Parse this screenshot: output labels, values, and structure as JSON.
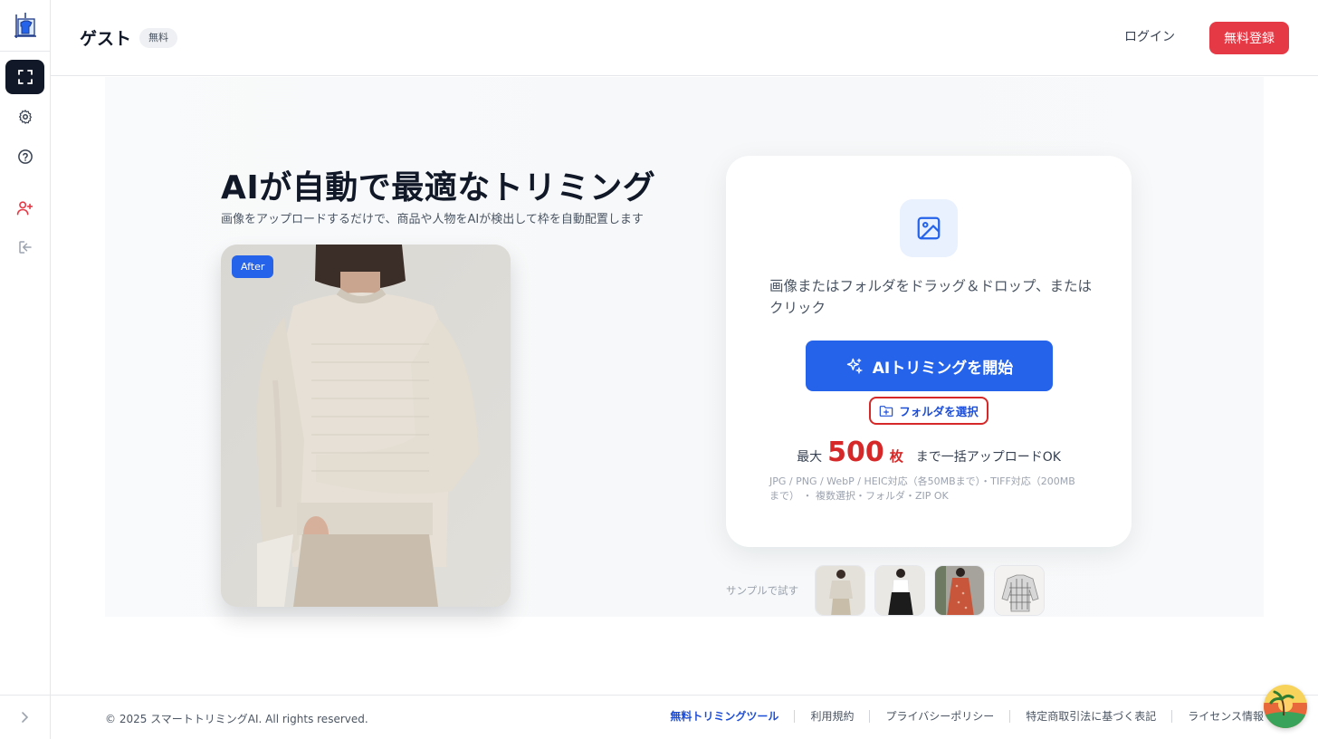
{
  "header": {
    "user_name": "ゲスト",
    "plan_badge": "無料",
    "login_label": "ログイン",
    "signup_label": "無料登録"
  },
  "sidebar": {
    "items": [
      {
        "icon": "crop-frame-icon",
        "active": true
      },
      {
        "icon": "gear-icon",
        "active": false
      },
      {
        "icon": "help-circle-icon",
        "active": false
      },
      {
        "icon": "add-user-icon",
        "active": false
      },
      {
        "icon": "sign-in-icon",
        "active": false
      }
    ],
    "expand_icon": "chevron-right-icon"
  },
  "hero": {
    "title": "AIが自動で最適なトリミング",
    "subtitle": "画像をアップロードするだけで、商品や人物をAIが検出して枠を自動配置します",
    "photo_badge": "After"
  },
  "upload": {
    "drop_text": "画像またはフォルダをドラッグ＆ドロップ、またはクリック",
    "start_button": "AIトリミングを開始",
    "folder_button": "フォルダを選択",
    "limit_prefix": "最大",
    "limit_number": "500",
    "limit_unit": "枚",
    "limit_suffix": "まで一括アップロードOK",
    "formats": "JPG / PNG / WebP / HEIC対応（各50MBまで）・TIFF対応（200MBまで） ・ 複数選択・フォルダ・ZIP OK"
  },
  "samples": {
    "label": "サンプルで試す",
    "count": 4
  },
  "footer": {
    "copyright": "© 2025 スマートトリミングAI. All rights reserved.",
    "links": [
      "無料トリミングツール",
      "利用規約",
      "プライバシーポリシー",
      "特定商取引法に基づく表記",
      "ライセンス情報"
    ]
  },
  "colors": {
    "primary": "#2563eb",
    "danger": "#e63946",
    "limit_red": "#d62828",
    "sidebar_active": "#111827"
  }
}
